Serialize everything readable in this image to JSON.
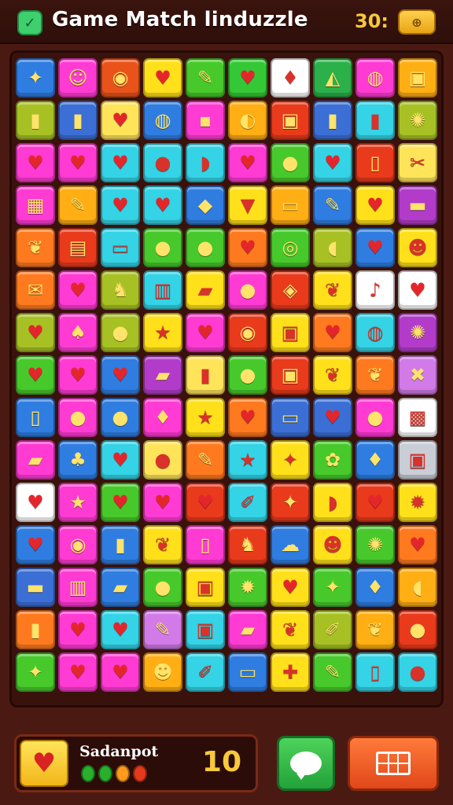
{
  "header": {
    "title": "Game Match linduzzle",
    "score": "30:",
    "logo_icon": "checkbox-icon",
    "coin_icon": "coin-icon"
  },
  "board": {
    "columns": 10,
    "rows": 15,
    "tiles": [
      [
        {
          "c": "#2f7de1",
          "g": "✦",
          "i": "leaf-icon"
        },
        {
          "c": "#ff3bd3",
          "g": "☺",
          "i": "smiley-icon"
        },
        {
          "c": "#e9531a",
          "g": "◉",
          "i": "disc-icon"
        },
        {
          "c": "#ffe01a",
          "g": "♥",
          "i": "heart-icon"
        },
        {
          "c": "#47c92b",
          "g": "✎",
          "i": "pencil-icon"
        },
        {
          "c": "#35c836",
          "g": "♥",
          "i": "heart-icon"
        },
        {
          "c": "#ffffff",
          "g": "♦",
          "i": "gem-icon"
        },
        {
          "c": "#2bb04a",
          "g": "◭",
          "i": "shape-icon"
        },
        {
          "c": "#ff3bd3",
          "g": "◍",
          "i": "ring-icon"
        },
        {
          "c": "#ffae14",
          "g": "▣",
          "i": "box-icon"
        }
      ],
      [
        {
          "c": "#a7c124",
          "g": "▮",
          "i": "bottle-icon"
        },
        {
          "c": "#3b6fd6",
          "g": "▮",
          "i": "bottle-icon"
        },
        {
          "c": "#ffe45a",
          "g": "♥",
          "i": "heart-icon"
        },
        {
          "c": "#2f7de1",
          "g": "◍",
          "i": "ball-icon"
        },
        {
          "c": "#ff3bd3",
          "g": "▪",
          "i": "cube-icon"
        },
        {
          "c": "#ffae14",
          "g": "◐",
          "i": "moon-icon"
        },
        {
          "c": "#e93a1c",
          "g": "▣",
          "i": "chest-icon"
        },
        {
          "c": "#3b6fd6",
          "g": "▮",
          "i": "jar-icon"
        },
        {
          "c": "#34d3e6",
          "g": "▮",
          "i": "cup-icon"
        },
        {
          "c": "#a7c124",
          "g": "✺",
          "i": "wheel-icon"
        }
      ],
      [
        {
          "c": "#ff3bd3",
          "g": "♥",
          "i": "heart-icon"
        },
        {
          "c": "#ff3bd3",
          "g": "♥",
          "i": "heart-icon"
        },
        {
          "c": "#34d3e6",
          "g": "♥",
          "i": "heart-icon"
        },
        {
          "c": "#34d3e6",
          "g": "●",
          "i": "apple-icon"
        },
        {
          "c": "#34d3e6",
          "g": "◗",
          "i": "bread-icon"
        },
        {
          "c": "#ff3bd3",
          "g": "♥",
          "i": "heart-icon"
        },
        {
          "c": "#47c92b",
          "g": "●",
          "i": "apple-icon"
        },
        {
          "c": "#34d3e6",
          "g": "♥",
          "i": "heart-icon"
        },
        {
          "c": "#e93a1c",
          "g": "▯",
          "i": "card-icon"
        },
        {
          "c": "#ffe45a",
          "g": "✂",
          "i": "scissors-icon"
        }
      ],
      [
        {
          "c": "#ff3bd3",
          "g": "▦",
          "i": "grid-icon"
        },
        {
          "c": "#ffae14",
          "g": "✎",
          "i": "pencil-icon"
        },
        {
          "c": "#34d3e6",
          "g": "♥",
          "i": "heart-icon"
        },
        {
          "c": "#34d3e6",
          "g": "♥",
          "i": "heart-icon"
        },
        {
          "c": "#2f7de1",
          "g": "◆",
          "i": "cheese-icon"
        },
        {
          "c": "#ffe01a",
          "g": "▼",
          "i": "basket-icon"
        },
        {
          "c": "#ffae14",
          "g": "▭",
          "i": "block-icon"
        },
        {
          "c": "#2f7de1",
          "g": "✎",
          "i": "pen-icon"
        },
        {
          "c": "#ffe01a",
          "g": "♥",
          "i": "heart-icon"
        },
        {
          "c": "#b23cc9",
          "g": "▬",
          "i": "bar-icon"
        }
      ],
      [
        {
          "c": "#ff7a1f",
          "g": "❦",
          "i": "leaf-icon"
        },
        {
          "c": "#e93a1c",
          "g": "▤",
          "i": "crate-icon"
        },
        {
          "c": "#34d3e6",
          "g": "▭",
          "i": "eraser-icon"
        },
        {
          "c": "#47c92b",
          "g": "●",
          "i": "drop-icon"
        },
        {
          "c": "#47c92b",
          "g": "●",
          "i": "orange-icon"
        },
        {
          "c": "#ff7a1f",
          "g": "♥",
          "i": "heart-icon"
        },
        {
          "c": "#47c92b",
          "g": "◎",
          "i": "ring-icon"
        },
        {
          "c": "#a7c124",
          "g": "◖",
          "i": "stone-icon"
        },
        {
          "c": "#2f7de1",
          "g": "♥",
          "i": "heart-icon"
        },
        {
          "c": "#ffe01a",
          "g": "☻",
          "i": "face-icon"
        }
      ],
      [
        {
          "c": "#ff7a1f",
          "g": "✉",
          "i": "envelope-icon"
        },
        {
          "c": "#ff3bd3",
          "g": "♥",
          "i": "heart-icon"
        },
        {
          "c": "#a7c124",
          "g": "♞",
          "i": "figure-icon"
        },
        {
          "c": "#34d3e6",
          "g": "▥",
          "i": "can-icon"
        },
        {
          "c": "#ffe01a",
          "g": "▰",
          "i": "brick-icon"
        },
        {
          "c": "#ff3bd3",
          "g": "●",
          "i": "apple-icon"
        },
        {
          "c": "#e93a1c",
          "g": "◈",
          "i": "candy-icon"
        },
        {
          "c": "#ffe01a",
          "g": "❦",
          "i": "pepper-icon"
        },
        {
          "c": "#ffffff",
          "g": "♪",
          "i": "key-icon"
        },
        {
          "c": "#ffffff",
          "g": "♥",
          "i": "heart-icon"
        }
      ],
      [
        {
          "c": "#a7c124",
          "g": "♥",
          "i": "heart-icon"
        },
        {
          "c": "#ff3bd3",
          "g": "♠",
          "i": "berry-icon"
        },
        {
          "c": "#a7c124",
          "g": "●",
          "i": "apple-icon"
        },
        {
          "c": "#ffe01a",
          "g": "★",
          "i": "star-icon"
        },
        {
          "c": "#ff3bd3",
          "g": "♥",
          "i": "heart-icon"
        },
        {
          "c": "#e93a1c",
          "g": "◉",
          "i": "target-icon"
        },
        {
          "c": "#ffe01a",
          "g": "▣",
          "i": "box-icon"
        },
        {
          "c": "#ff7a1f",
          "g": "♥",
          "i": "heart-icon"
        },
        {
          "c": "#34d3e6",
          "g": "◍",
          "i": "ball-icon"
        },
        {
          "c": "#b23cc9",
          "g": "✺",
          "i": "flower-icon"
        }
      ],
      [
        {
          "c": "#47c92b",
          "g": "♥",
          "i": "heart-icon"
        },
        {
          "c": "#ff3bd3",
          "g": "♥",
          "i": "heart-icon"
        },
        {
          "c": "#2f7de1",
          "g": "♥",
          "i": "heart-icon"
        },
        {
          "c": "#b23cc9",
          "g": "▰",
          "i": "bar-icon"
        },
        {
          "c": "#ffe45a",
          "g": "▮",
          "i": "bottle-icon"
        },
        {
          "c": "#47c92b",
          "g": "●",
          "i": "plum-icon"
        },
        {
          "c": "#e93a1c",
          "g": "▣",
          "i": "box-icon"
        },
        {
          "c": "#ffe01a",
          "g": "❦",
          "i": "pepper-icon"
        },
        {
          "c": "#ff7a1f",
          "g": "❦",
          "i": "leaf-icon"
        },
        {
          "c": "#d27be8",
          "g": "✖",
          "i": "bow-icon"
        }
      ],
      [
        {
          "c": "#2f7de1",
          "g": "▯",
          "i": "card-icon"
        },
        {
          "c": "#ff3bd3",
          "g": "●",
          "i": "lemon-icon"
        },
        {
          "c": "#2f7de1",
          "g": "●",
          "i": "ball-icon"
        },
        {
          "c": "#ff3bd3",
          "g": "♦",
          "i": "gem-icon"
        },
        {
          "c": "#ffe01a",
          "g": "★",
          "i": "star-icon"
        },
        {
          "c": "#ff7a1f",
          "g": "♥",
          "i": "heart-icon"
        },
        {
          "c": "#3b6fd6",
          "g": "▭",
          "i": "bar-icon"
        },
        {
          "c": "#3b6fd6",
          "g": "♥",
          "i": "heart-icon"
        },
        {
          "c": "#ff3bd3",
          "g": "●",
          "i": "orange-icon"
        },
        {
          "c": "#ffffff",
          "g": "▩",
          "i": "frame-icon"
        }
      ],
      [
        {
          "c": "#ff3bd3",
          "g": "▰",
          "i": "bar-icon"
        },
        {
          "c": "#2f7de1",
          "g": "♣",
          "i": "flower-icon"
        },
        {
          "c": "#34d3e6",
          "g": "♥",
          "i": "heart-icon"
        },
        {
          "c": "#ffe45a",
          "g": "●",
          "i": "apple-icon"
        },
        {
          "c": "#ff7a1f",
          "g": "✎",
          "i": "pencil-icon"
        },
        {
          "c": "#34d3e6",
          "g": "★",
          "i": "star-icon"
        },
        {
          "c": "#ffe01a",
          "g": "✦",
          "i": "leaf-icon"
        },
        {
          "c": "#47c92b",
          "g": "✿",
          "i": "flower-icon"
        },
        {
          "c": "#2f7de1",
          "g": "♦",
          "i": "gem-icon"
        },
        {
          "c": "#c9cdd6",
          "g": "▣",
          "i": "box-icon"
        }
      ],
      [
        {
          "c": "#ffffff",
          "g": "♥",
          "i": "heart-icon"
        },
        {
          "c": "#ff3bd3",
          "g": "★",
          "i": "star-icon"
        },
        {
          "c": "#47c92b",
          "g": "♥",
          "i": "heart-icon"
        },
        {
          "c": "#ff3bd3",
          "g": "♥",
          "i": "heart-icon"
        },
        {
          "c": "#e93a1c",
          "g": "♥",
          "i": "heart-icon"
        },
        {
          "c": "#34d3e6",
          "g": "✐",
          "i": "nail-icon"
        },
        {
          "c": "#e93a1c",
          "g": "✦",
          "i": "leaf-icon"
        },
        {
          "c": "#ffe01a",
          "g": "◗",
          "i": "drumstick-icon"
        },
        {
          "c": "#e93a1c",
          "g": "♥",
          "i": "heart-icon"
        },
        {
          "c": "#ffe01a",
          "g": "✹",
          "i": "cookie-icon"
        }
      ],
      [
        {
          "c": "#2f7de1",
          "g": "♥",
          "i": "heart-icon"
        },
        {
          "c": "#ff3bd3",
          "g": "◉",
          "i": "orb-icon"
        },
        {
          "c": "#2f7de1",
          "g": "▮",
          "i": "cup-icon"
        },
        {
          "c": "#ffe01a",
          "g": "❦",
          "i": "pepper-icon"
        },
        {
          "c": "#ff3bd3",
          "g": "▯",
          "i": "card-icon"
        },
        {
          "c": "#e93a1c",
          "g": "♞",
          "i": "figure-icon"
        },
        {
          "c": "#2f7de1",
          "g": "☁",
          "i": "cloud-icon"
        },
        {
          "c": "#ffe01a",
          "g": "☻",
          "i": "face-icon"
        },
        {
          "c": "#47c92b",
          "g": "✺",
          "i": "flower-icon"
        },
        {
          "c": "#ff7a1f",
          "g": "♥",
          "i": "heart-icon"
        }
      ],
      [
        {
          "c": "#3b6fd6",
          "g": "▬",
          "i": "bar-icon"
        },
        {
          "c": "#ff3bd3",
          "g": "▥",
          "i": "can-icon"
        },
        {
          "c": "#2f7de1",
          "g": "▰",
          "i": "brick-icon"
        },
        {
          "c": "#47c92b",
          "g": "●",
          "i": "apple-icon"
        },
        {
          "c": "#ffe01a",
          "g": "▣",
          "i": "gift-icon"
        },
        {
          "c": "#47c92b",
          "g": "✹",
          "i": "flower-icon"
        },
        {
          "c": "#ffe01a",
          "g": "♥",
          "i": "heart-icon"
        },
        {
          "c": "#47c92b",
          "g": "✦",
          "i": "leaf-icon"
        },
        {
          "c": "#2f7de1",
          "g": "♦",
          "i": "gem-icon"
        },
        {
          "c": "#ffae14",
          "g": "◖",
          "i": "bread-icon"
        }
      ],
      [
        {
          "c": "#ff7a1f",
          "g": "▮",
          "i": "bottle-icon"
        },
        {
          "c": "#ff3bd3",
          "g": "♥",
          "i": "heart-icon"
        },
        {
          "c": "#34d3e6",
          "g": "♥",
          "i": "heart-icon"
        },
        {
          "c": "#d27be8",
          "g": "✎",
          "i": "pencil-icon"
        },
        {
          "c": "#34d3e6",
          "g": "▣",
          "i": "box-icon"
        },
        {
          "c": "#ff3bd3",
          "g": "▰",
          "i": "candy-icon"
        },
        {
          "c": "#ffe01a",
          "g": "❦",
          "i": "pepper-icon"
        },
        {
          "c": "#a7c124",
          "g": "✐",
          "i": "nail-icon"
        },
        {
          "c": "#ffae14",
          "g": "❦",
          "i": "bone-icon"
        },
        {
          "c": "#e93a1c",
          "g": "●",
          "i": "lollipop-icon"
        }
      ],
      [
        {
          "c": "#47c92b",
          "g": "✦",
          "i": "leaf-icon"
        },
        {
          "c": "#ff3bd3",
          "g": "♥",
          "i": "heart-icon"
        },
        {
          "c": "#ff3bd3",
          "g": "♥",
          "i": "heart-icon"
        },
        {
          "c": "#ffae14",
          "g": "☻",
          "i": "face-icon"
        },
        {
          "c": "#34d3e6",
          "g": "✐",
          "i": "hammer-icon"
        },
        {
          "c": "#2f7de1",
          "g": "▭",
          "i": "block-icon"
        },
        {
          "c": "#ffe01a",
          "g": "✚",
          "i": "cross-icon"
        },
        {
          "c": "#47c92b",
          "g": "✎",
          "i": "pen-icon"
        },
        {
          "c": "#34d3e6",
          "g": "▯",
          "i": "phone-icon"
        },
        {
          "c": "#34d3e6",
          "g": "●",
          "i": "apple-icon"
        }
      ]
    ]
  },
  "bottom": {
    "label": "Sadanpot",
    "count": "10",
    "dots": [
      "#28b02c",
      "#28b02c",
      "#ff9a1a",
      "#e23a1a"
    ],
    "heart_icon": "heart-icon",
    "chat_icon": "chat-bubble-icon",
    "grid_icon": "grid-icon"
  }
}
